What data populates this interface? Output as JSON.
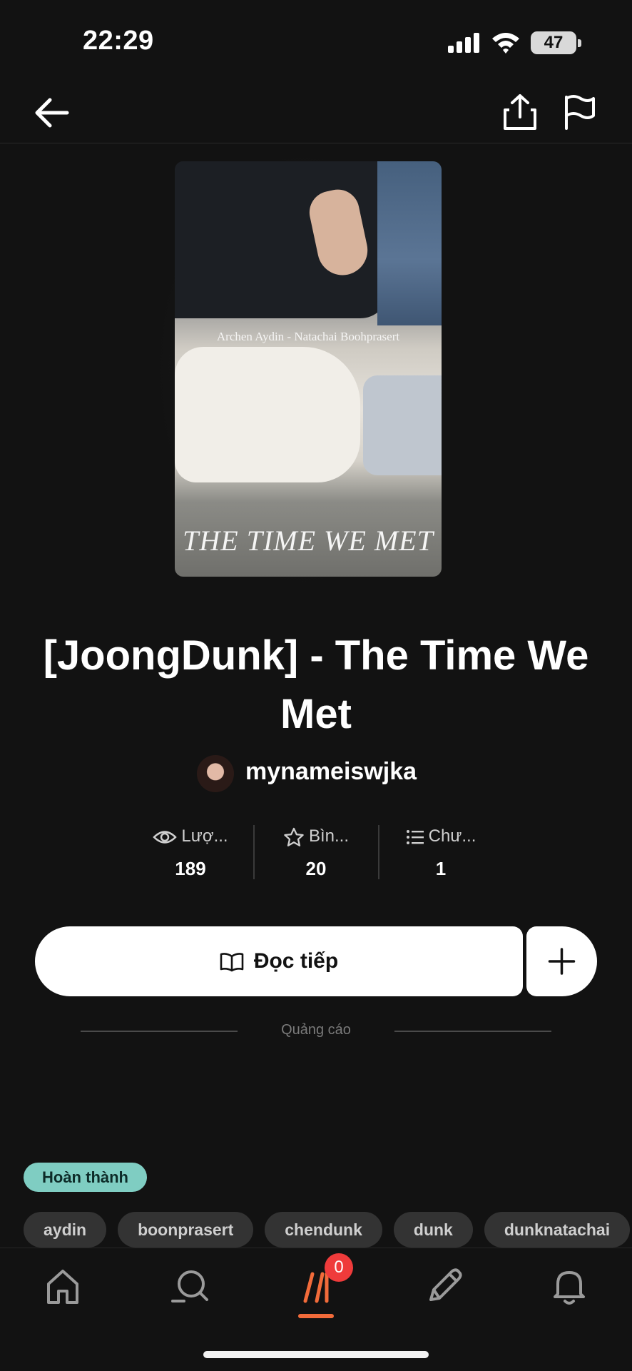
{
  "status_bar": {
    "time": "22:29",
    "battery": "47"
  },
  "cover": {
    "author_line": "Archen Aydin - Natachai Boohprasert",
    "title_text": "THE TIME WE MET"
  },
  "story": {
    "title": "[JoongDunk] - The Time We Met",
    "author": "mynameiswjka"
  },
  "stats": [
    {
      "icon": "eye-icon",
      "label": "Lượ...",
      "value": "189"
    },
    {
      "icon": "star-icon",
      "label": "Bìn...",
      "value": "20"
    },
    {
      "icon": "list-icon",
      "label": "Chư...",
      "value": "1"
    }
  ],
  "actions": {
    "read_label": "Đọc tiếp"
  },
  "ad": {
    "label": "Quảng cáo"
  },
  "status_tag": "Hoàn thành",
  "tags": [
    "aydin",
    "boonprasert",
    "chendunk",
    "dunk",
    "dunknatachai"
  ],
  "bottom_nav": {
    "items": [
      "home-icon",
      "search-icon",
      "library-icon",
      "write-icon",
      "bell-icon"
    ],
    "library_badge": "0"
  },
  "colors": {
    "background": "#121212",
    "accent": "#f26b3a",
    "badge": "#ef3b3b",
    "status_tag": "#7fcdc2"
  }
}
